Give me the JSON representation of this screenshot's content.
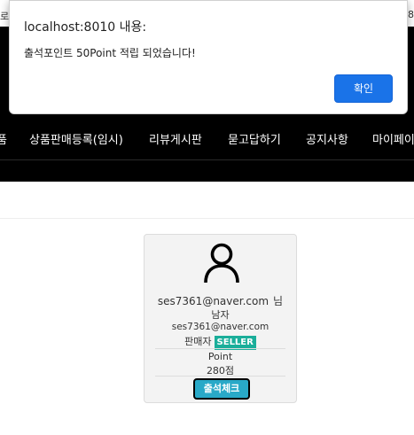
{
  "page": {
    "top_edge_left": "로",
    "top_edge_right": "8"
  },
  "navbar": {
    "items": [
      {
        "label": "품"
      },
      {
        "label": "상품판매등록(임시)"
      },
      {
        "label": "리뷰게시판"
      },
      {
        "label": "묻고답하기"
      },
      {
        "label": "공지사항"
      },
      {
        "label": "마이페이"
      }
    ]
  },
  "profile_card": {
    "avatar_icon": "user-icon",
    "email": "ses7361@naver.com",
    "honorific": "님",
    "gender": "남자",
    "email_sub": "ses7361@naver.com",
    "role_label": "판매자",
    "role_badge": "SELLER",
    "point_label": "Point",
    "point_value": "280점",
    "attendance_button": "출석체크",
    "colors": {
      "badge": "#1aae9a",
      "attendance_button": "#29a9c8"
    }
  },
  "alert_dialog": {
    "title": "localhost:8010 내용:",
    "message": "출석포인트 50Point 적립 되었습니다!",
    "ok_label": "확인",
    "colors": {
      "ok_button": "#1a73e8"
    }
  }
}
